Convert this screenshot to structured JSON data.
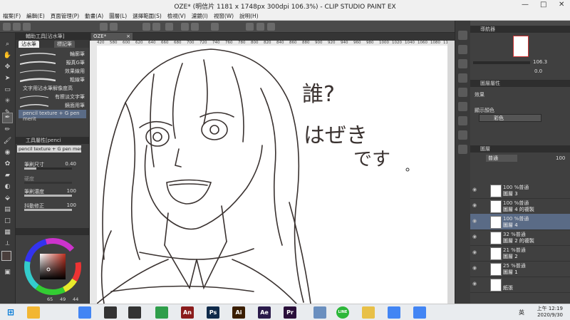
{
  "window": {
    "title": "OZE* (明信片 1181 x 1748px 300dpi 106.3%) - CLIP STUDIO PAINT EX",
    "minimize": "—",
    "maximize": "□",
    "close": "✕"
  },
  "menu": [
    "檔案(F)",
    "編輯(E)",
    "頁面管理(P)",
    "動畫(A)",
    "圖層(L)",
    "選擇範圍(S)",
    "檢視(V)",
    "濾鏡(I)",
    "視窗(W)",
    "說明(H)"
  ],
  "subtool_panel": {
    "title": "輔助工具[沾水筆]",
    "tabs": [
      "沾水筆",
      "標記筆"
    ],
    "brushes": [
      "輪廓筆",
      "擬真G筆",
      "效果線用",
      "粗線筆",
      "文字用沾水筆解像度高",
      "有擦淡文字筆",
      "鏡面用筆"
    ],
    "selected": "pencil texture + G pen merit"
  },
  "tool_property": {
    "title": "工具屬性[penci",
    "name": "pencil texture + G pen merit",
    "rows": [
      {
        "label": "筆刷尺寸",
        "value": "0.40",
        "fill": 0.25
      },
      {
        "label": "硬度",
        "value": "",
        "fill": 0.0
      },
      {
        "label": "筆刷濃度",
        "value": "100",
        "fill": 1.0
      },
      {
        "label": "抖動修正",
        "value": "100",
        "fill": 1.0
      }
    ]
  },
  "color": {
    "h": "65",
    "s": "49",
    "v": "44",
    "main": "#4a3f3c",
    "accent": "#3b6fd1"
  },
  "document": {
    "tab": "OZE*",
    "ruler_marks": [
      "420",
      "580",
      "600",
      "620",
      "640",
      "660",
      "680",
      "700",
      "720",
      "740",
      "760",
      "780",
      "800",
      "820",
      "840",
      "860",
      "880",
      "900",
      "920",
      "940",
      "960",
      "980",
      "1000",
      "1020",
      "1040",
      "1060",
      "1080",
      "1100"
    ]
  },
  "canvas_text": {
    "line1": "誰?",
    "line2": "はぜき",
    "line3": "です"
  },
  "navigator": {
    "title": "導航器",
    "zoom": "106.3",
    "angle": "0.0"
  },
  "layer_property": {
    "title": "圖層屬性",
    "effect_label": "效果",
    "display_color_label": "顯示顏色",
    "display_color_value": "彩色"
  },
  "layers_panel": {
    "title": "圖層",
    "blend": "普通",
    "opacity": "100",
    "items": [
      {
        "opacity": "100 %普通",
        "name": "圖層 3",
        "selected": false
      },
      {
        "opacity": "100 %普通",
        "name": "圖層 4 的複製",
        "selected": false
      },
      {
        "opacity": "100 %普通",
        "name": "圖層 4",
        "selected": true
      },
      {
        "opacity": "32 %普通",
        "name": "圖層 2 的複製",
        "selected": false
      },
      {
        "opacity": "21 %普通",
        "name": "圖層 2",
        "selected": false
      },
      {
        "opacity": "25 %普通",
        "name": "圖層 1",
        "selected": false
      },
      {
        "opacity": "",
        "name": "紙張",
        "selected": false
      }
    ]
  },
  "taskbar": {
    "apps": [
      {
        "name": "file-explorer",
        "label": "",
        "color": "#f2b632"
      },
      {
        "name": "chrome",
        "label": "",
        "color": "#4285f4"
      },
      {
        "name": "clip-studio",
        "label": "",
        "color": "#333333"
      },
      {
        "name": "clip-studio-paint",
        "label": "",
        "color": "#333333"
      },
      {
        "name": "map-app",
        "label": "",
        "color": "#2e9e4a"
      },
      {
        "name": "animate",
        "label": "An",
        "color": "#8a1c1c"
      },
      {
        "name": "photoshop",
        "label": "Ps",
        "color": "#0f2a4a"
      },
      {
        "name": "illustrator",
        "label": "Ai",
        "color": "#3a1e00"
      },
      {
        "name": "after-effects",
        "label": "Ae",
        "color": "#2a1a4a"
      },
      {
        "name": "premiere",
        "label": "Pr",
        "color": "#2a0f3a"
      },
      {
        "name": "paint-app",
        "label": "",
        "color": "#6a8fbf"
      },
      {
        "name": "line",
        "label": "LINE",
        "color": "#2cb73a"
      },
      {
        "name": "folder",
        "label": "",
        "color": "#e8c048"
      },
      {
        "name": "chrome-2",
        "label": "",
        "color": "#4285f4"
      },
      {
        "name": "chrome-3",
        "label": "",
        "color": "#4285f4"
      }
    ],
    "ime": "英",
    "time": "上午 12:19",
    "date": "2020/9/30"
  }
}
